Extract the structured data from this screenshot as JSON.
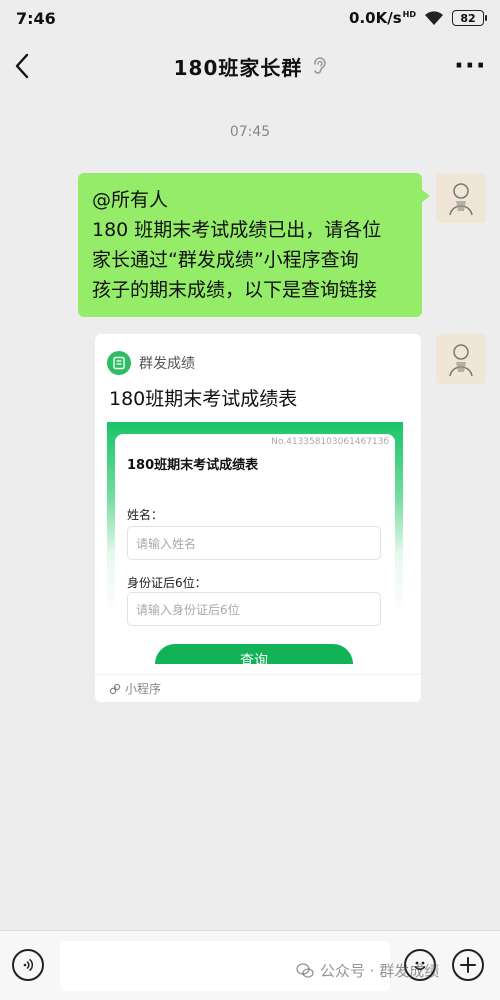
{
  "status_bar": {
    "time": "7:46",
    "net_speed": "0.0K/s",
    "hd_label": "HD",
    "battery": "82"
  },
  "nav": {
    "title": "180班家长群",
    "more_label": "···"
  },
  "chat": {
    "timestamp": "07:45",
    "text_message": {
      "lines": [
        "@所有人",
        "180 班期末考试成绩已出，请各位",
        "家长通过“群发成绩”小程序查询",
        "孩子的期末成绩，以下是查询链接"
      ]
    },
    "mini_program": {
      "app_name": "群发成绩",
      "title": "180班期末考试成绩表",
      "preview": {
        "serial": "No.41335810306146713б",
        "form_title": "180班期末考试成绩表",
        "name_label": "姓名：",
        "name_placeholder": "请输入姓名",
        "id_label": "身份证后6位：",
        "id_placeholder": "请输入身份证后6位",
        "query_button": "查询"
      },
      "footer_label": "小程序"
    }
  },
  "watermark": {
    "text": "公众号 · 群发成绩"
  },
  "colors": {
    "bubble_green": "#95ec69",
    "brand_green": "#12b257",
    "background": "#ededed"
  }
}
